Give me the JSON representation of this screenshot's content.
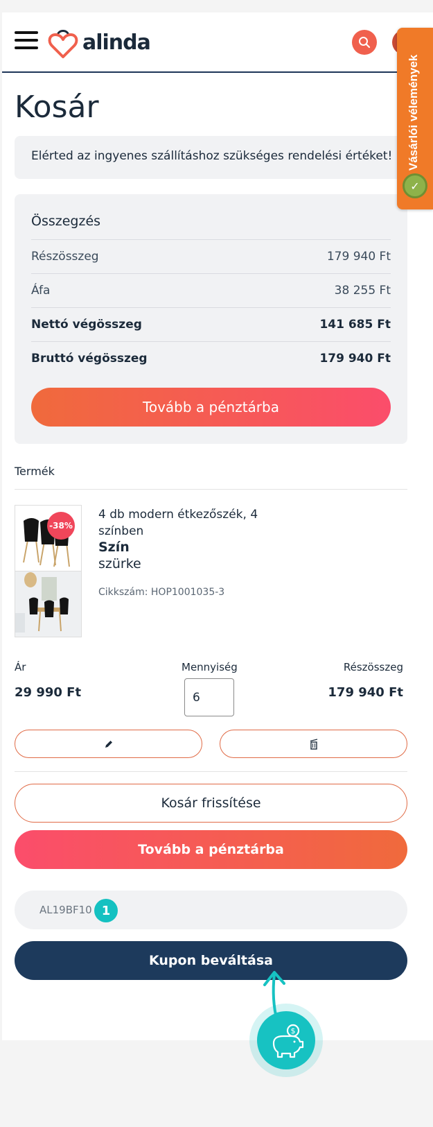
{
  "header": {
    "brand_name": "alinda",
    "reviews_tab_label": "Vásárlói vélemények"
  },
  "page_title": "Kosár",
  "free_shipping_notice": "Elérted az ingyenes szállításhoz szükséges rendelési értéket!",
  "summary": {
    "heading": "Összegzés",
    "rows": [
      {
        "label": "Részösszeg",
        "value": "179 940 Ft"
      },
      {
        "label": "Áfa",
        "value": "38 255 Ft"
      },
      {
        "label": "Nettó végösszeg",
        "value": "141 685 Ft"
      },
      {
        "label": "Bruttó végösszeg",
        "value": "179 940 Ft"
      }
    ],
    "checkout_label": "Tovább a pénztárba"
  },
  "product_section_label": "Termék",
  "product": {
    "name": "4 db modern étkezőszék, 4 színben",
    "attr_label": "Szín",
    "attr_value": "szürke",
    "sku": "Cikkszám: HOP1001035-3",
    "discount": "-38%",
    "price_label": "Ár",
    "price": "29 990 Ft",
    "qty_label": "Mennyiség",
    "qty": "6",
    "subtotal_label": "Részösszeg",
    "subtotal": "179 940 Ft"
  },
  "actions": {
    "edit_icon": "pencil-icon",
    "delete_icon": "trash-icon",
    "refresh_label": "Kosár frissítése",
    "checkout_label": "Tovább a pénztárba"
  },
  "coupon": {
    "code": "AL19BF10",
    "badge": "1",
    "redeem_label": "Kupon beváltása"
  },
  "colors": {
    "accent_orange": "#f06a3c",
    "accent_pink": "#fb4d6b",
    "navy": "#1d3a5c",
    "teal": "#17c2c2"
  }
}
